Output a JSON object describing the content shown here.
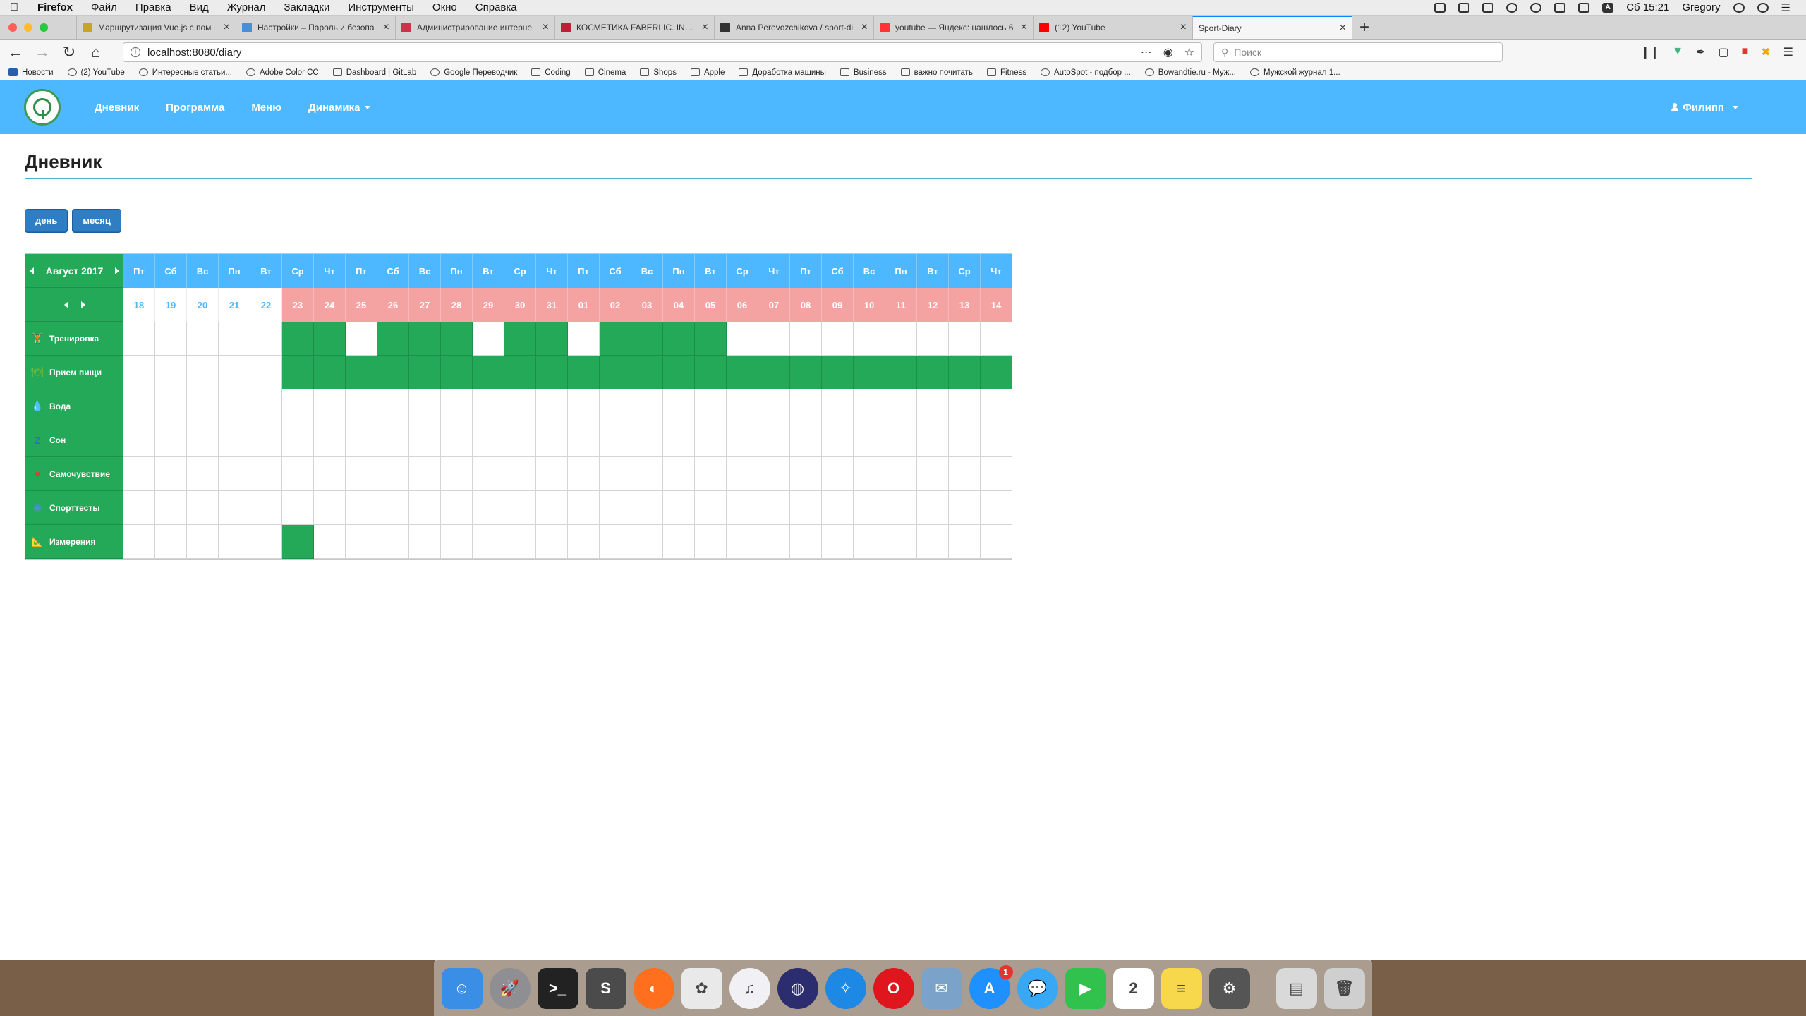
{
  "menubar": {
    "app": "Firefox",
    "items": [
      "Файл",
      "Правка",
      "Вид",
      "Журнал",
      "Закладки",
      "Инструменты",
      "Окно",
      "Справка"
    ],
    "clock": "Сб 15:21",
    "user": "Gregory"
  },
  "tabs": [
    {
      "title": "Маршрутизация Vue.js с пом"
    },
    {
      "title": "Настройки – Пароль и безопа"
    },
    {
      "title": "Администрирование интерне"
    },
    {
      "title": "КОСМЕТИКА FABERLIC. INFINI"
    },
    {
      "title": "Anna Perevozchikova / sport-di"
    },
    {
      "title": "youtube — Яндекс: нашлось 6"
    },
    {
      "title": "(12) YouTube"
    },
    {
      "title": "Sport-Diary"
    }
  ],
  "navbar": {
    "url": "localhost:8080/diary",
    "search_placeholder": "Поиск"
  },
  "bookmarks": [
    {
      "label": "Новости"
    },
    {
      "label": "(2) YouTube"
    },
    {
      "label": "Интересные статьи..."
    },
    {
      "label": "Adobe Color CC"
    },
    {
      "label": "Dashboard | GitLab"
    },
    {
      "label": "Google Переводчик"
    },
    {
      "label": "Coding"
    },
    {
      "label": "Cinema"
    },
    {
      "label": "Shops"
    },
    {
      "label": "Apple"
    },
    {
      "label": "Доработка машины"
    },
    {
      "label": "Business"
    },
    {
      "label": "важно почитать"
    },
    {
      "label": "Fitness"
    },
    {
      "label": "AutoSpot - подбор ..."
    },
    {
      "label": "Bowandtie.ru - Муж..."
    },
    {
      "label": "Мужской журнал 1..."
    }
  ],
  "app": {
    "nav": {
      "diary": "Дневник",
      "program": "Программа",
      "menu": "Меню",
      "dynamics": "Динамика"
    },
    "user_name": "Филипп",
    "page_title": "Дневник",
    "view_buttons": {
      "day": "день",
      "month": "месяц"
    }
  },
  "diary": {
    "month_label": "Август 2017",
    "weekdays": [
      "Пт",
      "Сб",
      "Вс",
      "Пн",
      "Вт",
      "Ср",
      "Чт",
      "Пт",
      "Сб",
      "Вс",
      "Пн",
      "Вт",
      "Ср",
      "Чт",
      "Пт",
      "Сб",
      "Вс",
      "Пн",
      "Вт",
      "Ср",
      "Чт",
      "Пт",
      "Сб",
      "Вс",
      "Пн",
      "Вт",
      "Ср",
      "Чт"
    ],
    "dates": [
      "18",
      "19",
      "20",
      "21",
      "22",
      "23",
      "24",
      "25",
      "26",
      "27",
      "28",
      "29",
      "30",
      "31",
      "01",
      "02",
      "03",
      "04",
      "05",
      "06",
      "07",
      "08",
      "09",
      "10",
      "11",
      "12",
      "13",
      "14"
    ],
    "future_from_index": 5,
    "colors": {
      "green": "#24a959",
      "blue": "#4db8ff",
      "pink": "#f4a2a2"
    },
    "rows": [
      {
        "label": "Тренировка",
        "icon": "dumbbell-icon",
        "glyph": "🏋",
        "icon_color": "#9aa",
        "filled": [
          5,
          6,
          8,
          9,
          10,
          12,
          13,
          15,
          16,
          17,
          18
        ]
      },
      {
        "label": "Прием пищи",
        "icon": "food-icon",
        "glyph": "🍽",
        "icon_color": "#6b4",
        "filled": [
          5,
          6,
          7,
          8,
          9,
          10,
          11,
          12,
          13,
          14,
          15,
          16,
          17,
          18,
          19,
          20,
          21,
          22,
          23,
          24,
          25,
          26,
          27
        ]
      },
      {
        "label": "Вода",
        "icon": "water-drop-icon",
        "glyph": "💧",
        "icon_color": "#3aa0ff",
        "filled": []
      },
      {
        "label": "Сон",
        "icon": "sleep-icon",
        "glyph": "Z",
        "icon_color": "#2a6fd6",
        "filled": []
      },
      {
        "label": "Самочувствие",
        "icon": "heart-icon",
        "glyph": "♥",
        "icon_color": "#e53935",
        "filled": []
      },
      {
        "label": "Спорттесты",
        "icon": "globe-icon",
        "glyph": "◉",
        "icon_color": "#4a90d9",
        "filled": []
      },
      {
        "label": "Измерения",
        "icon": "ruler-icon",
        "glyph": "📐",
        "icon_color": "#e8a33b",
        "filled": [
          5
        ]
      }
    ]
  },
  "dock": [
    {
      "name": "finder-app-icon",
      "glyph": "☺",
      "color": "#3a8ee6",
      "shape": "square"
    },
    {
      "name": "launchpad-app-icon",
      "glyph": "🚀",
      "color": "#8e8e93",
      "shape": "circle"
    },
    {
      "name": "terminal-app-icon",
      "glyph": ">_",
      "color": "#222222",
      "shape": "square"
    },
    {
      "name": "sublime-text-app-icon",
      "glyph": "S",
      "color": "#4b4b4b",
      "shape": "square"
    },
    {
      "name": "firefox-app-icon",
      "glyph": "◐",
      "color": "#ff6f1e",
      "shape": "circle"
    },
    {
      "name": "photos-app-icon",
      "glyph": "✿",
      "color": "#e9e9e9",
      "shape": "square"
    },
    {
      "name": "itunes-app-icon",
      "glyph": "♫",
      "color": "#f0f0f5",
      "shape": "circle"
    },
    {
      "name": "siri-app-icon",
      "glyph": "◍",
      "color": "#2b2d6e",
      "shape": "circle"
    },
    {
      "name": "safari-app-icon",
      "glyph": "✧",
      "color": "#1e88e5",
      "shape": "circle"
    },
    {
      "name": "opera-app-icon",
      "glyph": "O",
      "color": "#e0161e",
      "shape": "circle"
    },
    {
      "name": "preview-app-icon",
      "glyph": "✉",
      "color": "#7ba2c9",
      "shape": "square"
    },
    {
      "name": "app-store-app-icon",
      "glyph": "A",
      "color": "#1e90ff",
      "shape": "circle",
      "badge": "1"
    },
    {
      "name": "messages-app-icon",
      "glyph": "💬",
      "color": "#38a8f5",
      "shape": "circle"
    },
    {
      "name": "facetime-app-icon",
      "glyph": "▶",
      "color": "#30c24c",
      "shape": "square"
    },
    {
      "name": "calendar-app-icon",
      "glyph": "2",
      "color": "#ffffff",
      "shape": "square"
    },
    {
      "name": "notes-app-icon",
      "glyph": "≡",
      "color": "#f7d84c",
      "shape": "square"
    },
    {
      "name": "system-preferences-app-icon",
      "glyph": "⚙",
      "color": "#555555",
      "shape": "square"
    },
    {
      "name": "downloads-stack-icon",
      "glyph": "▤",
      "color": "#d9d9d9",
      "shape": "square"
    },
    {
      "name": "trash-icon",
      "glyph": "🗑",
      "color": "#cfcfcf",
      "shape": "square"
    }
  ]
}
